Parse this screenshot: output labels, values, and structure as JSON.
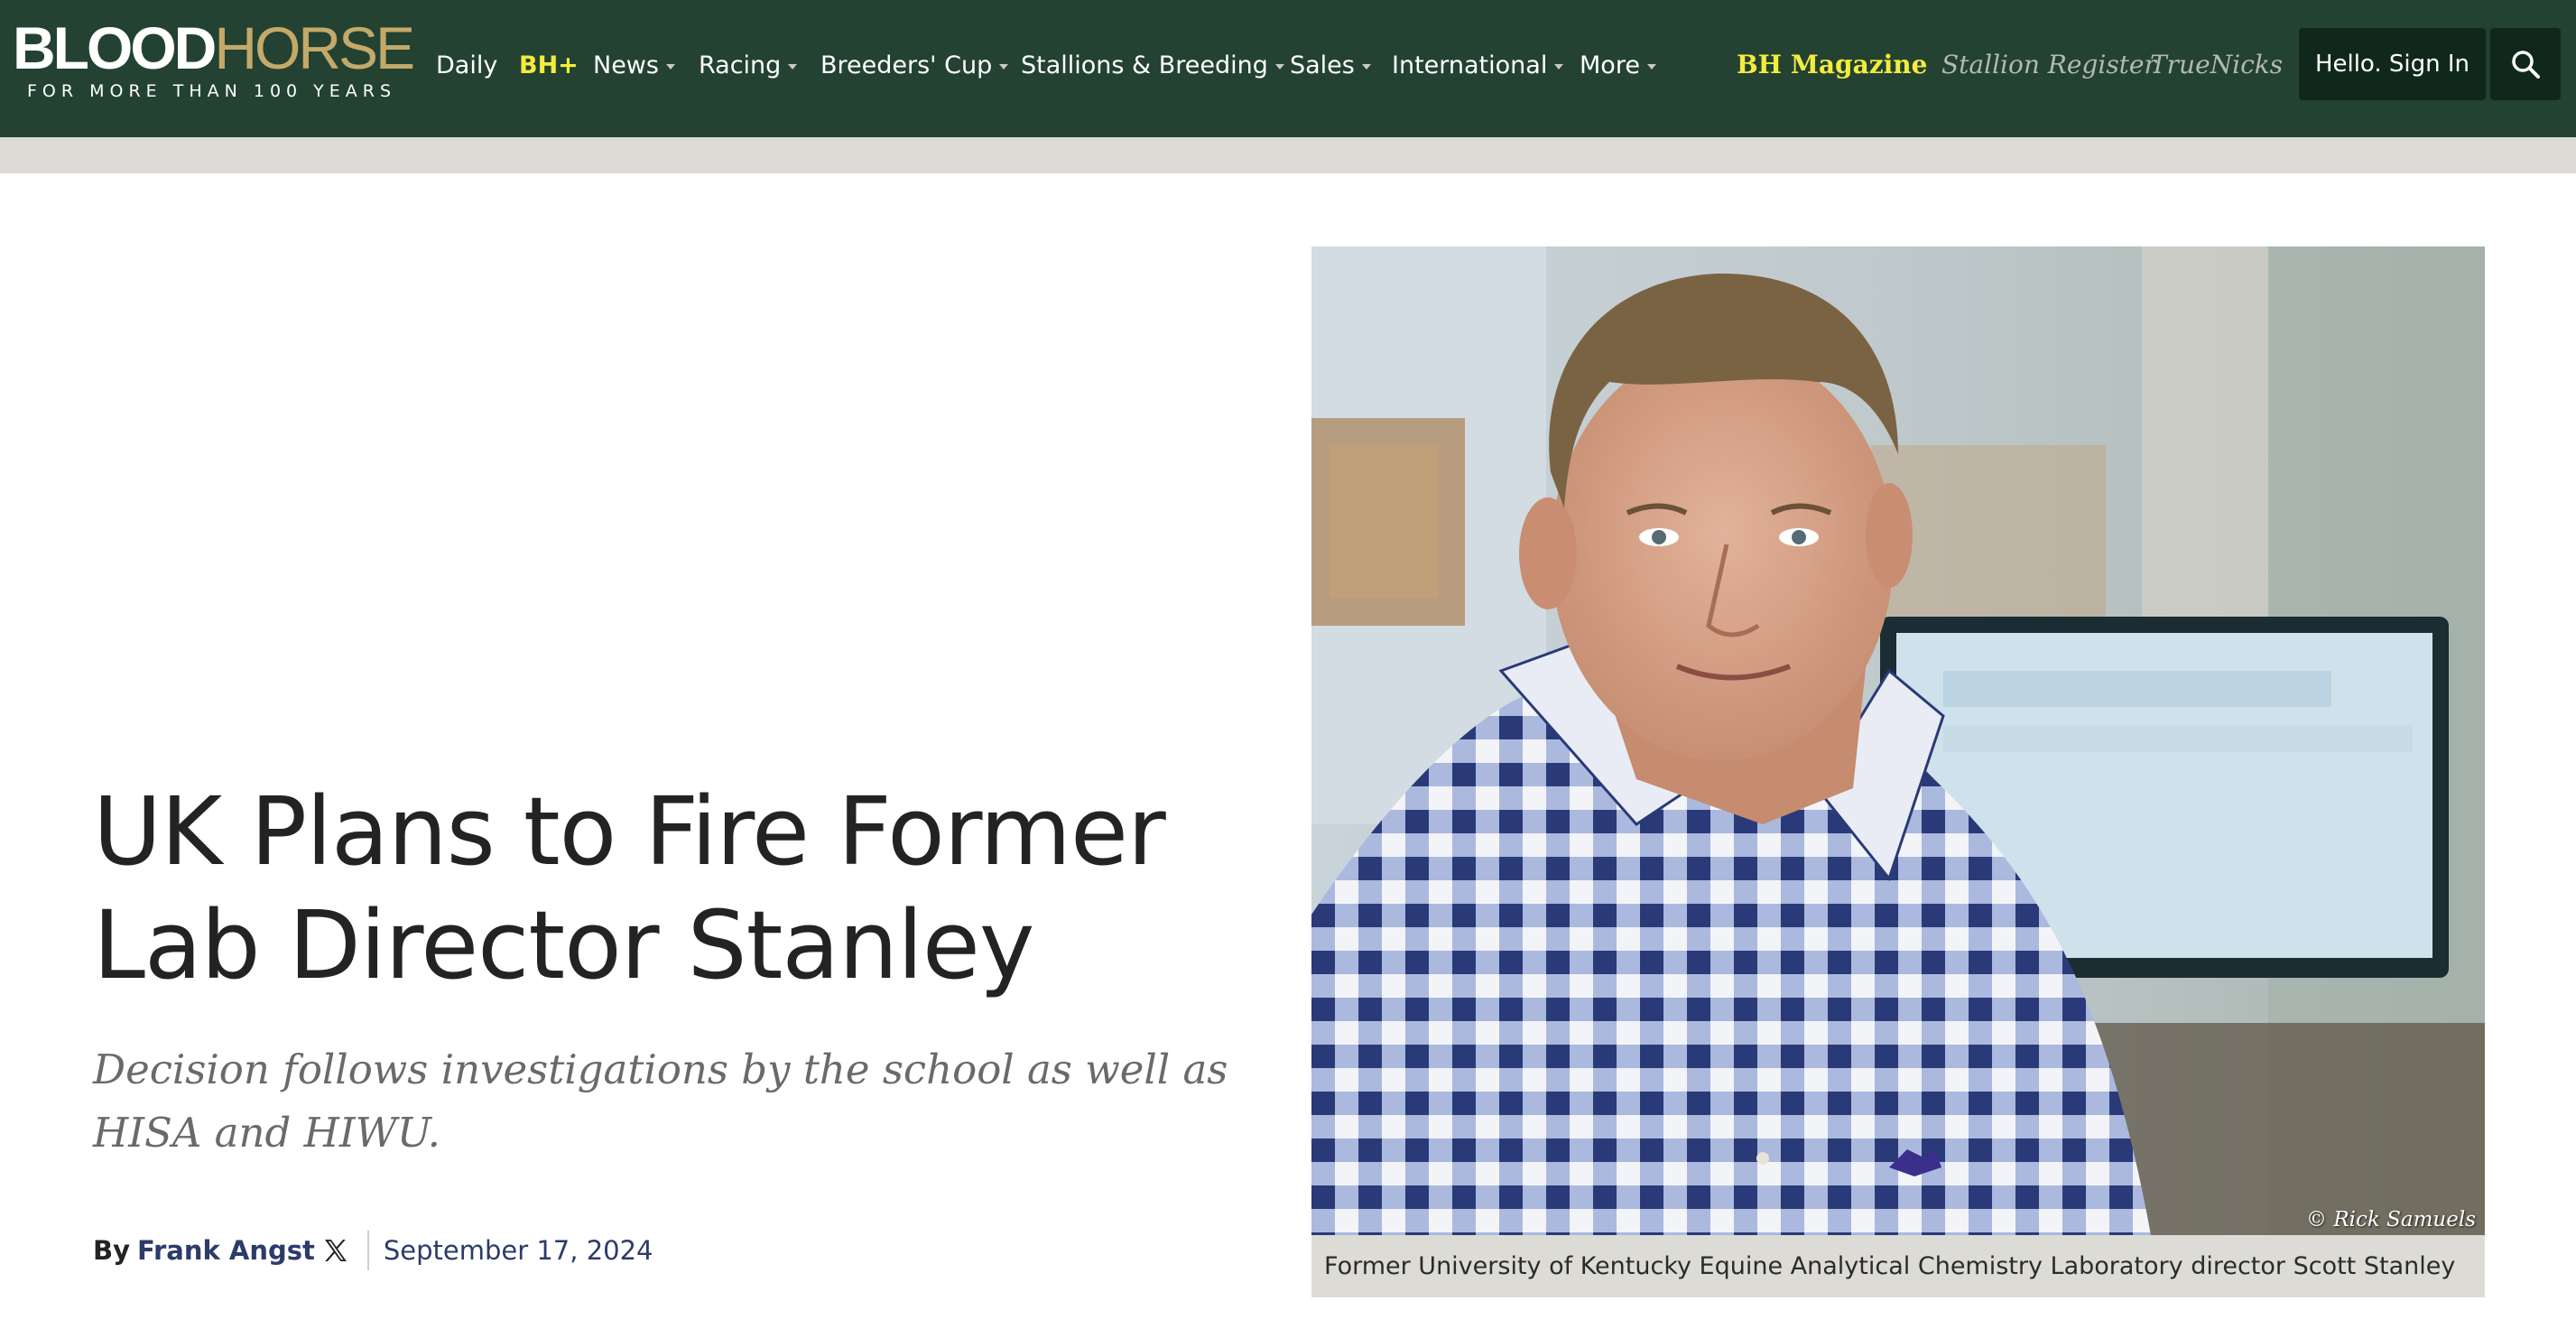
{
  "header": {
    "logo": {
      "part1": "BLOOD",
      "part2": "HORSE",
      "tagline": "FOR MORE THAN 100 YEARS"
    },
    "nav": [
      {
        "label": "Daily",
        "dropdown": false
      },
      {
        "label": "BH+",
        "dropdown": false
      },
      {
        "label": "News",
        "dropdown": true
      },
      {
        "label": "Racing",
        "dropdown": true
      },
      {
        "label": "Breeders' Cup",
        "dropdown": true
      },
      {
        "label": "Stallions & Breeding",
        "dropdown": true
      },
      {
        "label": "Sales",
        "dropdown": true
      },
      {
        "label": "International",
        "dropdown": true
      },
      {
        "label": "More",
        "dropdown": true
      }
    ],
    "publications": [
      "BH Magazine",
      "Stallion Register",
      "TrueNicks"
    ],
    "sign_in_label": "Hello. Sign In",
    "search_icon": "search-icon"
  },
  "article": {
    "headline_lines": [
      "UK Plans to Fire Former",
      "Lab Director Stanley"
    ],
    "subheadline_lines": [
      "Decision follows investigations by the school as well as",
      "HISA and HIWU."
    ],
    "byline_prefix": "By",
    "author": "Frank Angst",
    "author_social_icon": "x-twitter-icon",
    "date": "September 17, 2024"
  },
  "photo": {
    "credit": "© Rick Samuels",
    "caption": "Former University of Kentucky Equine Analytical Chemistry Laboratory director Scott Stanley"
  },
  "colors": {
    "header_bg": "#234232",
    "logo_gold": "#c3a96a",
    "accent_yellow": "#f4ec3d",
    "button_dark": "#10281b",
    "subbar_grey": "#dcdbd5",
    "link_navy": "#2c3b6a"
  }
}
